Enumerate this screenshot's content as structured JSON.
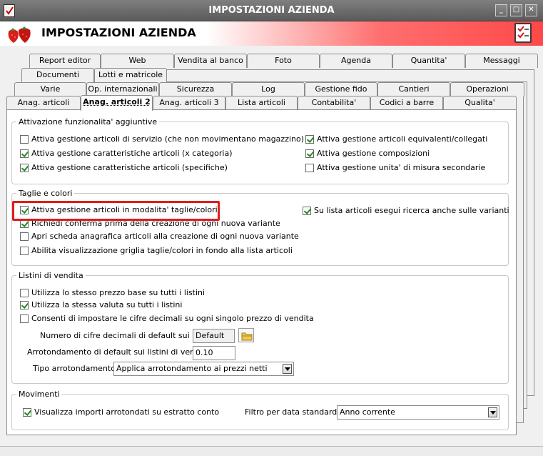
{
  "window": {
    "title": "IMPOSTAZIONI AZIENDA",
    "controls": {
      "minimize": "_",
      "maximize": "□",
      "close": "✕"
    }
  },
  "header": {
    "title": "IMPOSTAZIONI AZIENDA"
  },
  "tabs": {
    "row1": [
      "Report editor",
      "Web",
      "Vendita al banco",
      "Foto",
      "Agenda",
      "Quantita'",
      "Messaggi"
    ],
    "row2": [
      "Documenti",
      "Lotti e matricole"
    ],
    "row3": [
      "Varie",
      "Op. internazionali",
      "Sicurezza",
      "Log",
      "Gestione fido",
      "Cantieri",
      "Operazioni"
    ],
    "row4": [
      "Anag. articoli",
      "Anag. articoli 2",
      "Anag. articoli 3",
      "Lista articoli",
      "Contabilita'",
      "Codici a barre",
      "Qualita'"
    ],
    "active": "Anag. articoli 2"
  },
  "sections": {
    "attivazione": {
      "legend": "Attivazione funzionalita' aggiuntive",
      "left": [
        {
          "label": "Attiva gestione articoli di servizio (che non movimentano magazzino)",
          "checked": false
        },
        {
          "label": "Attiva gestione caratteristiche articoli (x categoria)",
          "checked": true
        },
        {
          "label": "Attiva gestione caratteristiche articoli (specifiche)",
          "checked": true
        }
      ],
      "right": [
        {
          "label": "Attiva gestione articoli equivalenti/collegati",
          "checked": true
        },
        {
          "label": "Attiva gestione composizioni",
          "checked": true
        },
        {
          "label": "Attiva gestione unita' di misura secondarie",
          "checked": false
        }
      ]
    },
    "taglie": {
      "legend": "Taglie e colori",
      "items": [
        {
          "label": "Attiva gestione articoli in modalita' taglie/colori",
          "checked": true
        },
        {
          "label": "Richiedi conferma prima della creazione di ogni nuova variante",
          "checked": true
        },
        {
          "label": "Apri scheda anagrafica articoli alla creazione di ogni nuova variante",
          "checked": false
        },
        {
          "label": "Abilita visualizzazione griglia taglie/colori in fondo alla lista articoli",
          "checked": false
        }
      ],
      "right": {
        "label": "Su lista articoli esegui ricerca anche sulle varianti",
        "checked": true
      }
    },
    "listini": {
      "legend": "Listini di vendita",
      "items": [
        {
          "label": "Utilizza lo stesso prezzo base su tutti i listini",
          "checked": false
        },
        {
          "label": "Utilizza la stessa valuta su tutti i listini",
          "checked": true
        },
        {
          "label": "Consenti di impostare le cifre decimali su ogni singolo prezzo di vendita",
          "checked": false
        }
      ],
      "decimali_label": "Numero di cifre decimali di default sui listini :",
      "decimali_value": "Default",
      "arrotondamento_label": "Arrotondamento di default sui listini di vendita :",
      "arrotondamento_value": "0.10",
      "tipo_label": "Tipo arrotondamento :",
      "tipo_value": "Applica arrotondamento ai prezzi netti"
    },
    "movimenti": {
      "legend": "Movimenti",
      "item": {
        "label": "Visualizza importi arrotondati su estratto conto",
        "checked": true
      },
      "filtro_label": "Filtro per data standard :",
      "filtro_value": "Anno corrente"
    }
  },
  "colors": {
    "titlebar": "#6e6e6e",
    "header_accent": "#ff4848",
    "highlight": "#e21b1b",
    "check": "#1c8a1c"
  }
}
